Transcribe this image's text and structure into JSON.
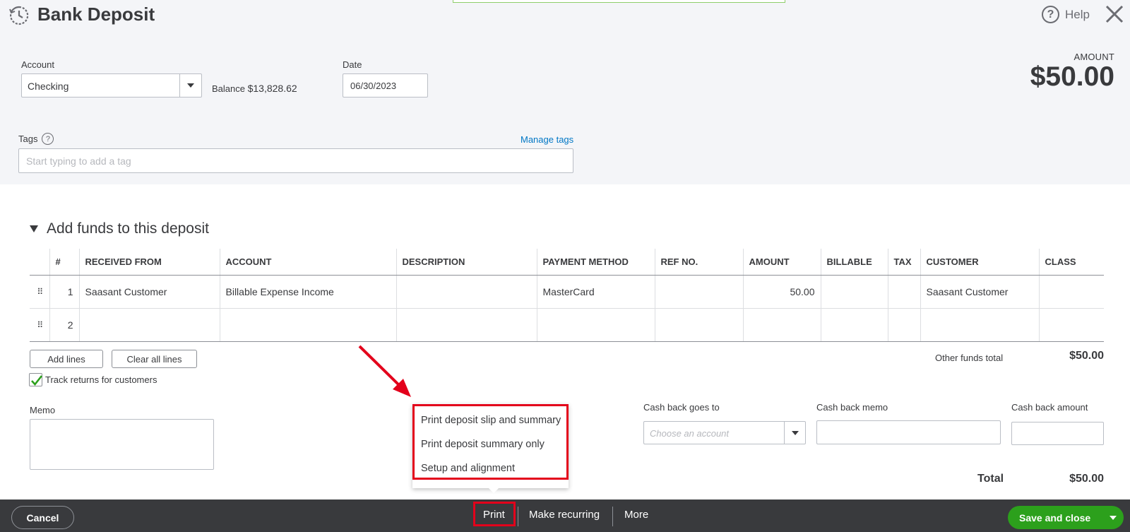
{
  "header": {
    "title": "Bank Deposit",
    "help_label": "Help",
    "help_symbol": "?",
    "amount_label": "AMOUNT",
    "amount_value": "$50.00"
  },
  "account": {
    "label": "Account",
    "value": "Checking",
    "balance_label": "Balance",
    "balance_value": "$13,828.62"
  },
  "date": {
    "label": "Date",
    "value": "06/30/2023"
  },
  "tags": {
    "label": "Tags",
    "help_symbol": "?",
    "manage_link": "Manage tags",
    "placeholder": "Start typing to add a tag"
  },
  "section": {
    "title": "Add funds to this deposit"
  },
  "table": {
    "headers": [
      "#",
      "RECEIVED FROM",
      "ACCOUNT",
      "DESCRIPTION",
      "PAYMENT METHOD",
      "REF NO.",
      "AMOUNT",
      "BILLABLE",
      "TAX",
      "CUSTOMER",
      "CLASS"
    ],
    "rows": [
      {
        "num": "1",
        "received_from": "Saasant Customer",
        "account": "Billable Expense Income",
        "description": "",
        "payment_method": "MasterCard",
        "ref_no": "",
        "amount": "50.00",
        "billable": "",
        "tax": "",
        "customer": "Saasant Customer",
        "class": ""
      },
      {
        "num": "2",
        "received_from": "",
        "account": "",
        "description": "",
        "payment_method": "",
        "ref_no": "",
        "amount": "",
        "billable": "",
        "tax": "",
        "customer": "",
        "class": ""
      }
    ]
  },
  "line_actions": {
    "add_lines": "Add lines",
    "clear_all": "Clear all lines",
    "track_returns": "Track returns for customers",
    "track_returns_checked": true
  },
  "other_funds": {
    "label": "Other funds total",
    "value": "$50.00"
  },
  "memo": {
    "label": "Memo"
  },
  "print_menu": {
    "items": [
      "Print deposit slip and summary",
      "Print deposit summary only",
      "Setup and alignment"
    ]
  },
  "cash_back": {
    "goes_to_label": "Cash back goes to",
    "goes_to_placeholder": "Choose an account",
    "memo_label": "Cash back memo",
    "amount_label": "Cash back amount"
  },
  "total": {
    "label": "Total",
    "value": "$50.00"
  },
  "footer": {
    "cancel": "Cancel",
    "print": "Print",
    "make_recurring": "Make recurring",
    "more": "More",
    "save_and_close": "Save and close"
  },
  "colors": {
    "accent_green": "#2ca01c",
    "link_blue": "#0077c5",
    "annotation_red": "#e3001b",
    "footer_bg": "#393a3d"
  }
}
